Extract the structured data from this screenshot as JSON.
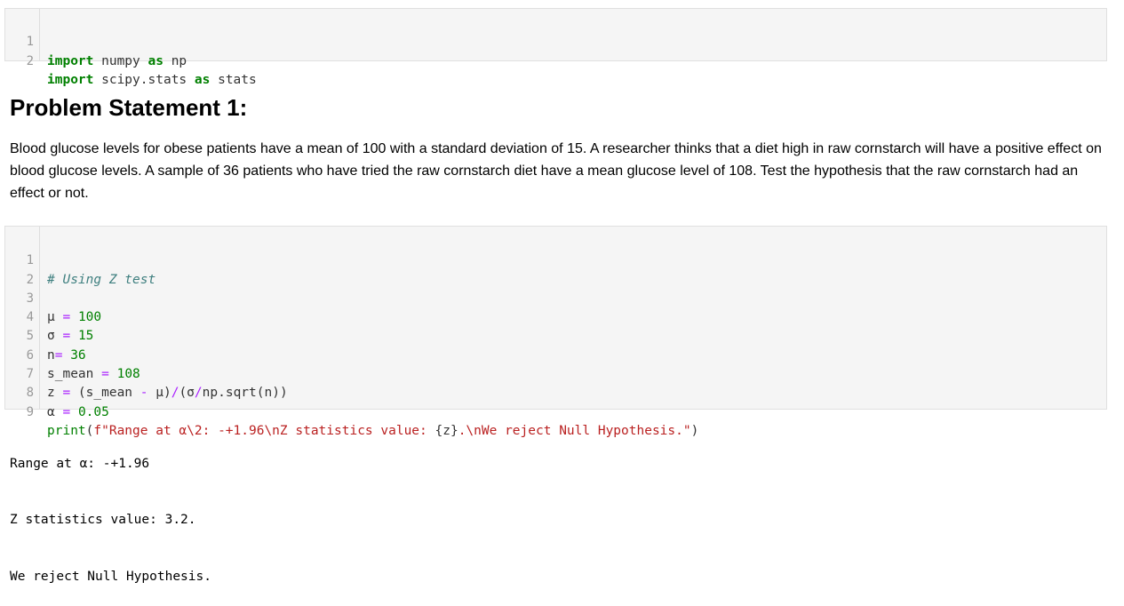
{
  "cell1": {
    "lines": [
      {
        "n": "1",
        "kw1": "import",
        "mod": " numpy ",
        "kw2": "as",
        "alias": " np"
      },
      {
        "n": "2",
        "kw1": "import",
        "mod": " scipy.stats ",
        "kw2": "as",
        "alias": " stats"
      }
    ]
  },
  "markdown": {
    "heading": "Problem Statement 1:",
    "body": "Blood glucose levels for obese patients have a mean of 100 with a standard deviation of 15. A researcher thinks that a diet high in raw cornstarch will have a positive effect on blood glucose levels. A sample of 36 patients who have tried the raw cornstarch diet have a mean glucose level of 108. Test the hypothesis that the raw cornstarch had an effect or not."
  },
  "cell2": {
    "line_numbers": [
      "1",
      "2",
      "3",
      "4",
      "5",
      "6",
      "7",
      "8",
      "9"
    ],
    "comment": "# Using Z test",
    "mu_var": "μ",
    "mu_val": "100",
    "sigma_var": "σ",
    "sigma_val": "15",
    "n_var": "n",
    "n_val": "36",
    "smean_var": "s_mean",
    "smean_val": "108",
    "z_expr_a": "z ",
    "z_expr_b": " (s_mean ",
    "z_expr_c": " μ)",
    "z_expr_d": "(σ",
    "z_expr_e": "np.sqrt(n))",
    "alpha_var": "α",
    "alpha_val": "0.05",
    "print_fn": "print",
    "print_open": "(",
    "print_str": "f\"Range at α\\2: -+1.96\\nZ statistics value: ",
    "print_fmt": "{z}",
    "print_str2": ".\\nWe reject Null Hypothesis.\"",
    "print_close": ")"
  },
  "output": {
    "lines": [
      "Range at α\u0002: -+1.96",
      "Z statistics value: 3.2.",
      "We reject Null Hypothesis."
    ]
  }
}
